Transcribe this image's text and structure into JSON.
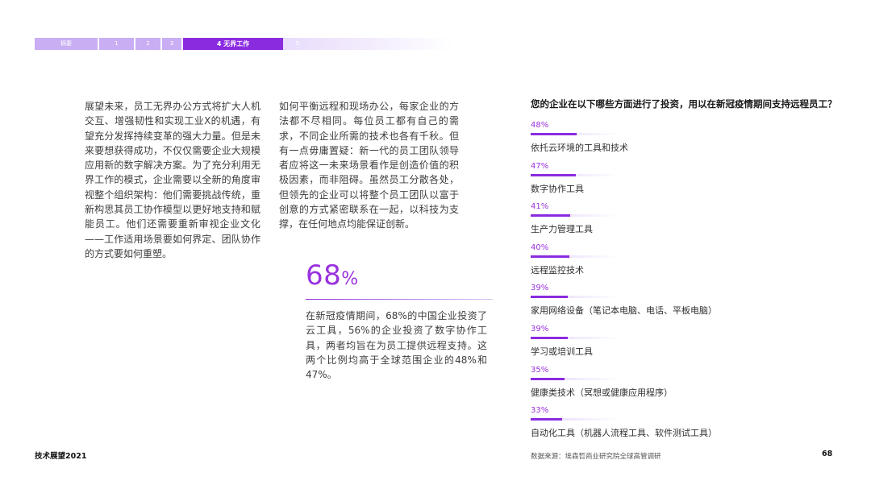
{
  "nav": {
    "items": [
      "摘要",
      "1",
      "2",
      "3",
      "4 无界工作",
      "5"
    ]
  },
  "content": {
    "para1": "展望未来，员工无界办公方式将扩大人机交互、增强韧性和实现工业X的机遇，有望充分发挥持续变革的强大力量。但是未来要想获得成功，不仅仅需要企业大规模应用新的数字解决方案。为了充分利用无界工作的模式，企业需要以全新的角度审视整个组织架构：他们需要挑战传统，重新构思其员工协作模型以更好地支持和赋能员工。他们还需要重新审视企业文化——工作适用场景要如何界定、团队协作的方式要如何重塑。",
    "para2": "如何平衡远程和现场办公，每家企业的方法都不尽相同。每位员工都有自己的需求，不同企业所需的技术也各有千秋。但有一点毋庸置疑：新一代的员工团队领导者应将这一未来场景看作是创造价值的积极因素，而非阻碍。虽然员工分散各处，但领先的企业可以将整个员工团队以富于创意的方式紧密联系在一起，以科技为支撑，在任何地点均能保证创新。",
    "stat_number": "68",
    "stat_unit": "%",
    "stat_desc": "在新冠疫情期间，68%的中国企业投资了云工具，56%的企业投资了数字协作工具，两者均旨在为员工提供远程支持。这两个比例均高于全球范围企业的48%和47%。"
  },
  "chart_data": {
    "type": "bar",
    "title": "您的企业在以下哪些方面进行了投资，用以在新冠疫情期间支持远程员工？",
    "categories": [
      "依托云环境的工具和技术",
      "数字协作工具",
      "生产力管理工具",
      "远程监控技术",
      "家用网络设备（笔记本电脑、电话、平板电脑）",
      "学习或培训工具",
      "健康类技术（冥想或健康应用程序）",
      "自动化工具（机器人流程工具、软件测试工具）"
    ],
    "values": [
      48,
      47,
      41,
      40,
      39,
      39,
      35,
      33
    ],
    "value_labels": [
      "48%",
      "47%",
      "41%",
      "40%",
      "39%",
      "39%",
      "35%",
      "33%"
    ],
    "xlim": [
      0,
      100
    ],
    "accent": "#8b2be0"
  },
  "footer": {
    "left": "技术展望2021",
    "source": "数据来源：埃森哲商业研究院全球高管调研",
    "page": "68"
  }
}
